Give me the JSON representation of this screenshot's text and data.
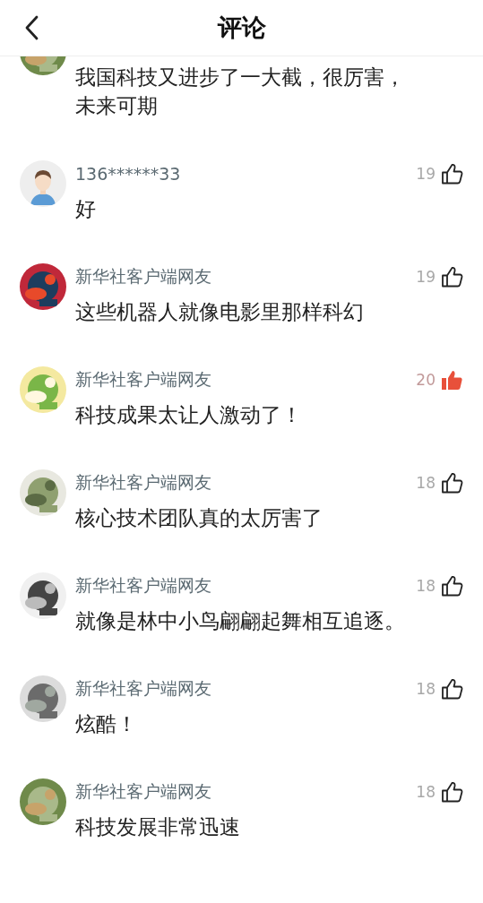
{
  "header": {
    "title": "评论"
  },
  "comments": [
    {
      "text": "我国科技又进步了一大截，很厉害，未来可期"
    },
    {
      "avatar": {
        "kind": "default"
      },
      "user": "136******33",
      "text": "好",
      "likes": "19",
      "liked": false
    },
    {
      "user": "新华社客户端网友",
      "text": "这些机器人就像电影里那样科幻",
      "likes": "19",
      "liked": false
    },
    {
      "user": "新华社客户端网友",
      "text": "科技成果太让人激动了！",
      "likes": "20",
      "liked": true
    },
    {
      "user": "新华社客户端网友",
      "text": "核心技术团队真的太厉害了",
      "likes": "18",
      "liked": false
    },
    {
      "user": "新华社客户端网友",
      "text": "就像是林中小鸟翩翩起舞相互追逐。",
      "likes": "18",
      "liked": false
    },
    {
      "user": "新华社客户端网友",
      "text": "炫酷！",
      "likes": "18",
      "liked": false
    },
    {
      "user": "新华社客户端网友",
      "text": "科技发展非常迅速",
      "likes": "18",
      "liked": false
    }
  ]
}
